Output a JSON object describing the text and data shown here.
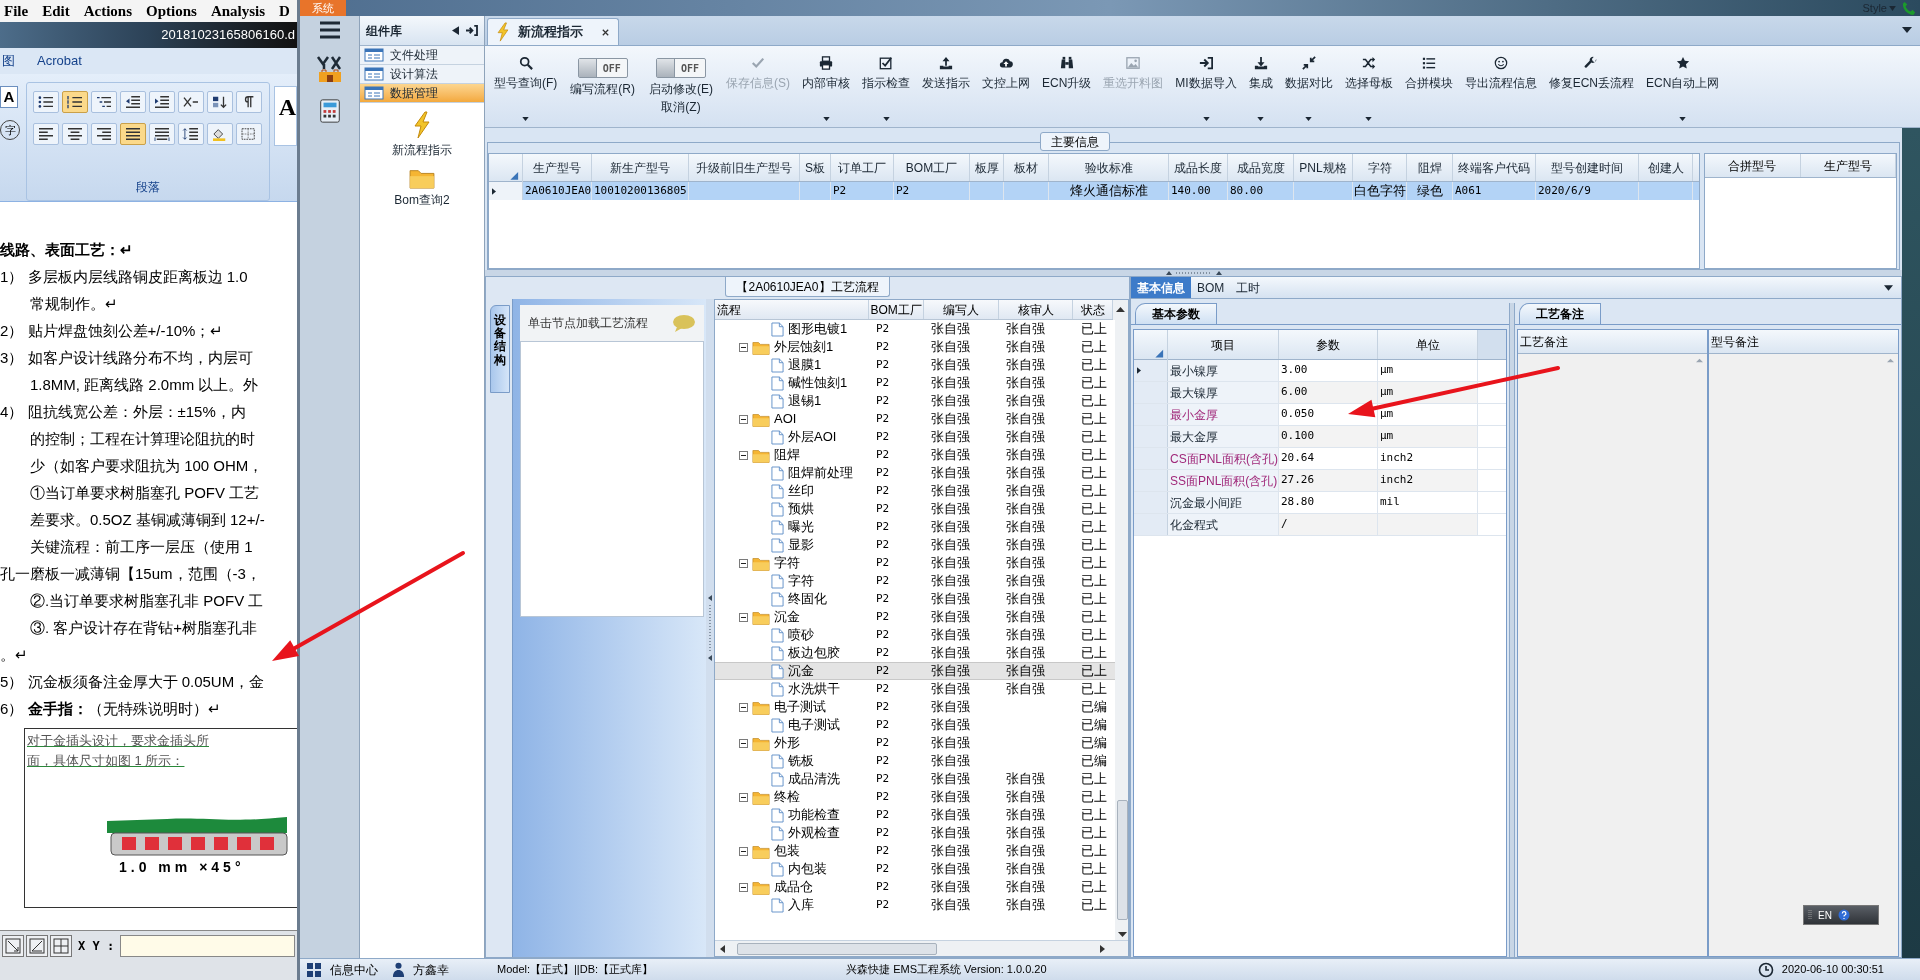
{
  "doc_window": {
    "menu": [
      "File",
      "Edit",
      "Actions",
      "Options",
      "Analysis",
      "D"
    ],
    "file_name": "20181023165806160.d",
    "ribbon_tabs": [
      "图",
      "Acrobat"
    ],
    "font_button": "A",
    "phonetic_button": "字",
    "style_preview": "A",
    "paragraph_buttons": [
      {
        "selected": false
      },
      {
        "selected": true
      },
      {
        "selected": false
      },
      {
        "selected": false
      },
      {
        "selected": false
      },
      {
        "selected": false
      },
      {
        "selected": false
      },
      {
        "selected": false
      },
      {
        "selected": false
      },
      {
        "selected": false
      },
      {
        "selected": false
      },
      {
        "selected": true
      },
      {
        "selected": false
      },
      {
        "selected": false
      },
      {
        "selected": false
      },
      {
        "selected": false
      }
    ],
    "group_label": "段落",
    "lines": [
      {
        "kind": "heading",
        "text": "线路、表面工艺：↵"
      },
      {
        "kind": "numbered",
        "text": "1）  多层板内层线路铜皮距离板边 1.0"
      },
      {
        "kind": "body",
        "text": "常规制作。↵"
      },
      {
        "kind": "numbered",
        "text": "2）  贴片焊盘蚀刻公差+/-10%；↵"
      },
      {
        "kind": "numbered",
        "text": "3）  如客户设计线路分布不均，内层可"
      },
      {
        "kind": "body",
        "text": "1.8MM, 距离线路 2.0mm 以上。外"
      },
      {
        "kind": "numbered",
        "text": "4）  阻抗线宽公差：外层：±15%，内"
      },
      {
        "kind": "body",
        "text": "的控制；工程在计算理论阻抗的时"
      },
      {
        "kind": "body",
        "text": "少（如客户要求阻抗为 100 OHM，"
      },
      {
        "kind": "body",
        "text": "①当订单要求树脂塞孔 POFV 工艺"
      },
      {
        "kind": "body",
        "text": "差要求。0.5OZ 基铜减薄铜到 12+/-"
      },
      {
        "kind": "body",
        "text": " 关键流程：前工序一层压（使用 1"
      },
      {
        "kind": "flush",
        "text": "孔一磨板一减薄铜【15um，范围（-3，"
      },
      {
        "kind": "body",
        "text": "②.当订单要求树脂塞孔非 POFV 工"
      },
      {
        "kind": "body",
        "text": "③. 客户设计存在背钻+树脂塞孔非"
      },
      {
        "kind": "flush",
        "text": "。↵"
      },
      {
        "kind": "numbered",
        "text": "5）  沉金板须备注金厚大于 0.05UM，金"
      },
      {
        "kind": "numbered",
        "text": "6）  **金手指：**（无特殊说明时）↵"
      }
    ],
    "figure": {
      "caption_lines": [
        "对于金插头设计，要求金插头所",
        "面，具体尺寸如图 1 所示："
      ],
      "dimension": "1.0 mm ×45°"
    },
    "coord_label": "X Y :"
  },
  "app": {
    "system_tab": "系统",
    "style_menu": "Style",
    "components": {
      "title": "组件库",
      "items": [
        {
          "label": "文件处理",
          "selected": false
        },
        {
          "label": "设计算法",
          "selected": false
        },
        {
          "label": "数据管理",
          "selected": true
        }
      ],
      "tools": [
        "新流程指示",
        "Bom查询2"
      ]
    },
    "tabs": [
      {
        "label": "新流程指示",
        "selected": true
      }
    ],
    "toolbar": [
      {
        "kind": "button",
        "label": [
          "型号查询(F)"
        ],
        "dropdown": true,
        "disabled": false
      },
      {
        "kind": "toggle",
        "label": [
          "编写流程(R)"
        ],
        "switch_text": "OFF",
        "on": false
      },
      {
        "kind": "toggle",
        "label": [
          "启动修改(E)",
          "取消(Z)"
        ],
        "switch_text": "OFF",
        "on": false
      },
      {
        "kind": "button",
        "label": [
          "保存信息(S)"
        ],
        "dropdown": false,
        "disabled": true
      },
      {
        "kind": "button",
        "label": [
          "内部审核"
        ],
        "dropdown": true,
        "disabled": false
      },
      {
        "kind": "button",
        "label": [
          "指示检查"
        ],
        "dropdown": true,
        "disabled": false
      },
      {
        "kind": "button",
        "label": [
          "发送指示"
        ],
        "dropdown": false,
        "disabled": false
      },
      {
        "kind": "button",
        "label": [
          "文控上网"
        ],
        "dropdown": false,
        "disabled": false
      },
      {
        "kind": "button",
        "label": [
          "ECN升级"
        ],
        "dropdown": false,
        "disabled": false
      },
      {
        "kind": "button",
        "label": [
          "重选开料图"
        ],
        "dropdown": false,
        "disabled": true
      },
      {
        "kind": "button",
        "label": [
          "MI数据导入"
        ],
        "dropdown": true,
        "disabled": false
      },
      {
        "kind": "button",
        "label": [
          "集成"
        ],
        "dropdown": true,
        "disabled": false
      },
      {
        "kind": "button",
        "label": [
          "数据对比"
        ],
        "dropdown": true,
        "disabled": false
      },
      {
        "kind": "button",
        "label": [
          "选择母板"
        ],
        "dropdown": true,
        "disabled": false
      },
      {
        "kind": "button",
        "label": [
          "合拼模块"
        ],
        "dropdown": false,
        "disabled": false
      },
      {
        "kind": "button",
        "label": [
          "导出流程信息"
        ],
        "dropdown": false,
        "disabled": false
      },
      {
        "kind": "button",
        "label": [
          "修复ECN丢流程"
        ],
        "dropdown": false,
        "disabled": false
      },
      {
        "kind": "button",
        "label": [
          "ECN自动上网"
        ],
        "dropdown": true,
        "disabled": false
      }
    ],
    "main_info": {
      "title": "主要信息",
      "columns": [
        "生产型号",
        "新生产型号",
        "升级前旧生产型号",
        "S板",
        "订单工厂",
        "BOM工厂",
        "板厚",
        "板材",
        "验收标准",
        "成品长度",
        "成品宽度",
        "PNL规格",
        "字符",
        "阻焊",
        "终端客户代码",
        "型号创建时间",
        "创建人"
      ],
      "rows": [
        {
          "selected": true,
          "cells": [
            "2A0610JEA0",
            "10010200136805",
            null,
            null,
            "P2",
            "P2",
            null,
            null,
            "烽火通信标准",
            "140.00",
            "80.00",
            null,
            "白色字符",
            "绿色",
            "A061",
            "2020/6/9",
            null
          ]
        }
      ],
      "side_columns": [
        "合拼型号",
        "生产型号"
      ]
    },
    "flow": {
      "title": "【2A0610JEA0】工艺流程",
      "side_tab": "设备结构",
      "hint": "单击节点加载工艺流程",
      "columns": [
        "流程",
        "BOM工厂",
        "编写人",
        "核审人",
        "状态"
      ],
      "tree": [
        {
          "kind": "step",
          "label": "图形电镀1",
          "factory": "P2",
          "writer": "张自强",
          "reviewer": "张自强",
          "status": "已上",
          "selected": false
        },
        {
          "kind": "group",
          "label": "外层蚀刻1",
          "factory": "P2",
          "writer": "张自强",
          "reviewer": "张自强",
          "status": "已上",
          "selected": false,
          "expanded": true,
          "children": [
            {
              "kind": "step",
              "label": "退膜1",
              "factory": "P2",
              "writer": "张自强",
              "reviewer": "张自强",
              "status": "已上",
              "selected": false
            },
            {
              "kind": "step",
              "label": "碱性蚀刻1",
              "factory": "P2",
              "writer": "张自强",
              "reviewer": "张自强",
              "status": "已上",
              "selected": false
            },
            {
              "kind": "step",
              "label": "退锡1",
              "factory": "P2",
              "writer": "张自强",
              "reviewer": "张自强",
              "status": "已上",
              "selected": false
            }
          ]
        },
        {
          "kind": "group",
          "label": "AOI",
          "factory": "P2",
          "writer": "张自强",
          "reviewer": "张自强",
          "status": "已上",
          "selected": false,
          "expanded": true,
          "children": [
            {
              "kind": "step",
              "label": "外层AOI",
              "factory": "P2",
              "writer": "张自强",
              "reviewer": "张自强",
              "status": "已上",
              "selected": false
            }
          ]
        },
        {
          "kind": "group",
          "label": "阻焊",
          "factory": "P2",
          "writer": "张自强",
          "reviewer": "张自强",
          "status": "已上",
          "selected": false,
          "expanded": true,
          "children": [
            {
              "kind": "step",
              "label": "阻焊前处理",
              "factory": "P2",
              "writer": "张自强",
              "reviewer": "张自强",
              "status": "已上",
              "selected": false
            },
            {
              "kind": "step",
              "label": "丝印",
              "factory": "P2",
              "writer": "张自强",
              "reviewer": "张自强",
              "status": "已上",
              "selected": false
            },
            {
              "kind": "step",
              "label": "预烘",
              "factory": "P2",
              "writer": "张自强",
              "reviewer": "张自强",
              "status": "已上",
              "selected": false
            },
            {
              "kind": "step",
              "label": "曝光",
              "factory": "P2",
              "writer": "张自强",
              "reviewer": "张自强",
              "status": "已上",
              "selected": false
            },
            {
              "kind": "step",
              "label": "显影",
              "factory": "P2",
              "writer": "张自强",
              "reviewer": "张自强",
              "status": "已上",
              "selected": false
            }
          ]
        },
        {
          "kind": "group",
          "label": "字符",
          "factory": "P2",
          "writer": "张自强",
          "reviewer": "张自强",
          "status": "已上",
          "selected": false,
          "expanded": true,
          "children": [
            {
              "kind": "step",
              "label": "字符",
              "factory": "P2",
              "writer": "张自强",
              "reviewer": "张自强",
              "status": "已上",
              "selected": false
            },
            {
              "kind": "step",
              "label": "终固化",
              "factory": "P2",
              "writer": "张自强",
              "reviewer": "张自强",
              "status": "已上",
              "selected": false
            }
          ]
        },
        {
          "kind": "group",
          "label": "沉金",
          "factory": "P2",
          "writer": "张自强",
          "reviewer": "张自强",
          "status": "已上",
          "selected": false,
          "expanded": true,
          "children": [
            {
              "kind": "step",
              "label": "喷砂",
              "factory": "P2",
              "writer": "张自强",
              "reviewer": "张自强",
              "status": "已上",
              "selected": false
            },
            {
              "kind": "step",
              "label": "板边包胶",
              "factory": "P2",
              "writer": "张自强",
              "reviewer": "张自强",
              "status": "已上",
              "selected": false
            },
            {
              "kind": "step",
              "label": "沉金",
              "factory": "P2",
              "writer": "张自强",
              "reviewer": "张自强",
              "status": "已上",
              "selected": true
            },
            {
              "kind": "step",
              "label": "水洗烘干",
              "factory": "P2",
              "writer": "张自强",
              "reviewer": "张自强",
              "status": "已上",
              "selected": false
            }
          ]
        },
        {
          "kind": "group",
          "label": "电子测试",
          "factory": "P2",
          "writer": "张自强",
          "status": "已编",
          "selected": false,
          "expanded": true,
          "children": [
            {
              "kind": "step",
              "label": "电子测试",
              "factory": "P2",
              "writer": "张自强",
              "status": "已编",
              "selected": false
            }
          ]
        },
        {
          "kind": "group",
          "label": "外形",
          "factory": "P2",
          "writer": "张自强",
          "status": "已编",
          "selected": false,
          "expanded": true,
          "children": [
            {
              "kind": "step",
              "label": "铣板",
              "factory": "P2",
              "writer": "张自强",
              "status": "已编",
              "selected": false
            },
            {
              "kind": "step",
              "label": "成品清洗",
              "factory": "P2",
              "writer": "张自强",
              "reviewer": "张自强",
              "status": "已上",
              "selected": false
            }
          ]
        },
        {
          "kind": "group",
          "label": "终检",
          "factory": "P2",
          "writer": "张自强",
          "reviewer": "张自强",
          "status": "已上",
          "selected": false,
          "expanded": true,
          "children": [
            {
              "kind": "step",
              "label": "功能检查",
              "factory": "P2",
              "writer": "张自强",
              "reviewer": "张自强",
              "status": "已上",
              "selected": false
            },
            {
              "kind": "step",
              "label": "外观检查",
              "factory": "P2",
              "writer": "张自强",
              "reviewer": "张自强",
              "status": "已上",
              "selected": false
            }
          ]
        },
        {
          "kind": "group",
          "label": "包装",
          "factory": "P2",
          "writer": "张自强",
          "reviewer": "张自强",
          "status": "已上",
          "selected": false,
          "expanded": true,
          "children": [
            {
              "kind": "step",
              "label": "内包装",
              "factory": "P2",
              "writer": "张自强",
              "reviewer": "张自强",
              "status": "已上",
              "selected": false
            }
          ]
        },
        {
          "kind": "group",
          "label": "成品仓",
          "factory": "P2",
          "writer": "张自强",
          "reviewer": "张自强",
          "status": "已上",
          "selected": false,
          "expanded": true,
          "children": [
            {
              "kind": "step",
              "label": "入库",
              "factory": "P2",
              "writer": "张自强",
              "reviewer": "张自强",
              "status": "已上",
              "selected": false
            }
          ]
        }
      ]
    },
    "detail": {
      "tabs": [
        {
          "label": "基本信息",
          "selected": true
        },
        {
          "label": "BOM",
          "selected": false
        },
        {
          "label": "工时",
          "selected": false
        }
      ],
      "params": {
        "tab": "基本参数",
        "columns": [
          "项目",
          "参数",
          "单位"
        ],
        "rows": [
          {
            "item": "最小镍厚",
            "value": "3.00",
            "unit": "μm",
            "flagged": false,
            "selected": true
          },
          {
            "item": "最大镍厚",
            "value": "6.00",
            "unit": "μm",
            "flagged": false,
            "selected": false
          },
          {
            "item": "最小金厚",
            "value": "0.050",
            "unit": "μm",
            "flagged": true,
            "selected": false
          },
          {
            "item": "最大金厚",
            "value": "0.100",
            "unit": "μm",
            "flagged": false,
            "selected": false
          },
          {
            "item": "CS面PNL面积(含孔)",
            "value": "20.64",
            "unit": "inch2",
            "flagged": true,
            "selected": false
          },
          {
            "item": "SS面PNL面积(含孔)",
            "value": "27.26",
            "unit": "inch2",
            "flagged": true,
            "selected": false
          },
          {
            "item": "沉金最小间距",
            "value": "28.80",
            "unit": "mil",
            "flagged": false,
            "selected": false
          },
          {
            "item": "化金程式",
            "value": "/",
            "flagged": false,
            "selected": false
          }
        ]
      },
      "notes": {
        "tab": "工艺备注",
        "columns": [
          "工艺备注",
          "型号备注"
        ]
      }
    },
    "language_bar": "EN",
    "status_bar": {
      "info_center": "信息中心",
      "user": "方鑫幸",
      "model": "Model:【正式】||DB:【正式库】",
      "product": "兴森快捷 EMS工程系统 Version: 1.0.0.20",
      "time": "2020-06-10 00:30:51"
    }
  }
}
